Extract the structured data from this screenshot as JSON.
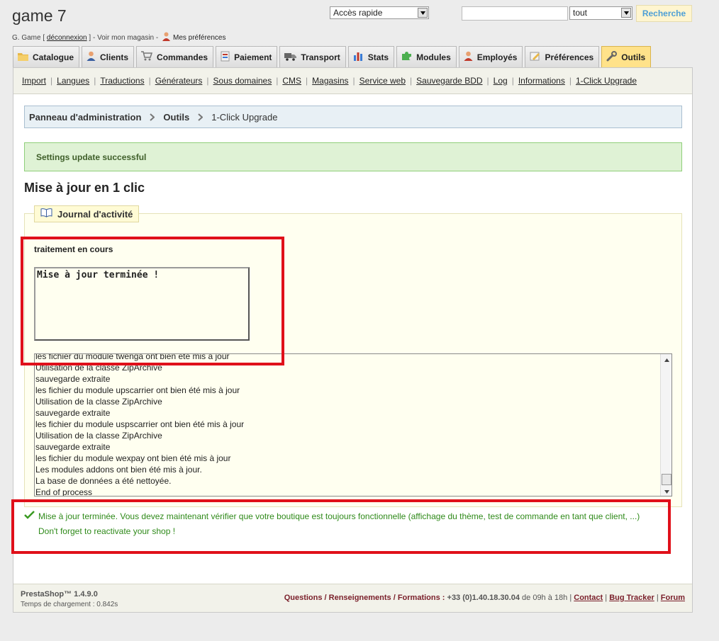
{
  "header": {
    "shop_name": "game 7",
    "user_prefix": "G. Game [",
    "logout": "déconnexion",
    "user_mid": "] - Voir mon magasin -",
    "preferences": "Mes préférences",
    "quick_access": "Accès rapide",
    "search_value": "",
    "search_scope": "tout",
    "search_button": "Recherche"
  },
  "tabs": [
    {
      "label": "Catalogue",
      "icon": "folder-icon"
    },
    {
      "label": "Clients",
      "icon": "customer-icon"
    },
    {
      "label": "Commandes",
      "icon": "cart-icon"
    },
    {
      "label": "Paiement",
      "icon": "payment-icon"
    },
    {
      "label": "Transport",
      "icon": "truck-icon"
    },
    {
      "label": "Stats",
      "icon": "stats-icon"
    },
    {
      "label": "Modules",
      "icon": "puzzle-icon"
    },
    {
      "label": "Employés",
      "icon": "employee-icon"
    },
    {
      "label": "Préférences",
      "icon": "preferences-icon"
    },
    {
      "label": "Outils",
      "icon": "wrench-icon",
      "active": true
    }
  ],
  "subnav": [
    "Import",
    "Langues",
    "Traductions",
    "Générateurs",
    "Sous domaines",
    "CMS",
    "Magasins",
    "Service web",
    "Sauvegarde BDD",
    "Log",
    "Informations",
    "1-Click Upgrade"
  ],
  "breadcrumb": [
    "Panneau d'administration",
    "Outils",
    "1-Click Upgrade"
  ],
  "success_message": "Settings update successful",
  "page_title": "Mise à jour en 1 clic",
  "legend": "Journal d'activité",
  "processing_label": "traitement en cours",
  "status_text": "Mise à jour terminée !",
  "log_lines": [
    "les fichier du module twenga ont bien été mis à jour",
    "Utilisation de la classe ZipArchive",
    "sauvegarde extraite",
    "les fichier du module upscarrier ont bien été mis à jour",
    "Utilisation de la classe ZipArchive",
    "sauvegarde extraite",
    "les fichier du module uspscarrier ont bien été mis à jour",
    "Utilisation de la classe ZipArchive",
    "sauvegarde extraite",
    "les fichier du module wexpay ont bien été mis à jour",
    "Les modules addons ont bien été mis à jour.",
    "La base de données a été nettoyée.",
    "End of process"
  ],
  "done_message": "Mise à jour terminée. Vous devez maintenant vérifier que votre boutique est toujours fonctionnelle (affichage du thème, test de commande en tant que client, ...)",
  "reactivate_message": "Don't forget to reactivate your shop !",
  "footer": {
    "version": "PrestaShop™ 1.4.9.0",
    "load_time": "Temps de chargement : 0.842s",
    "support_label": "Questions / Renseignements / Formations :",
    "phone": "+33 (0)1.40.18.30.04",
    "hours": "de 09h à 18h",
    "contact": "Contact",
    "bug_tracker": "Bug Tracker",
    "forum": "Forum"
  },
  "colors": {
    "active_tab": "#ffe28a",
    "success_bg": "#dff2d5",
    "highlight": "#e0101a",
    "done_text": "#2f8a1a"
  }
}
